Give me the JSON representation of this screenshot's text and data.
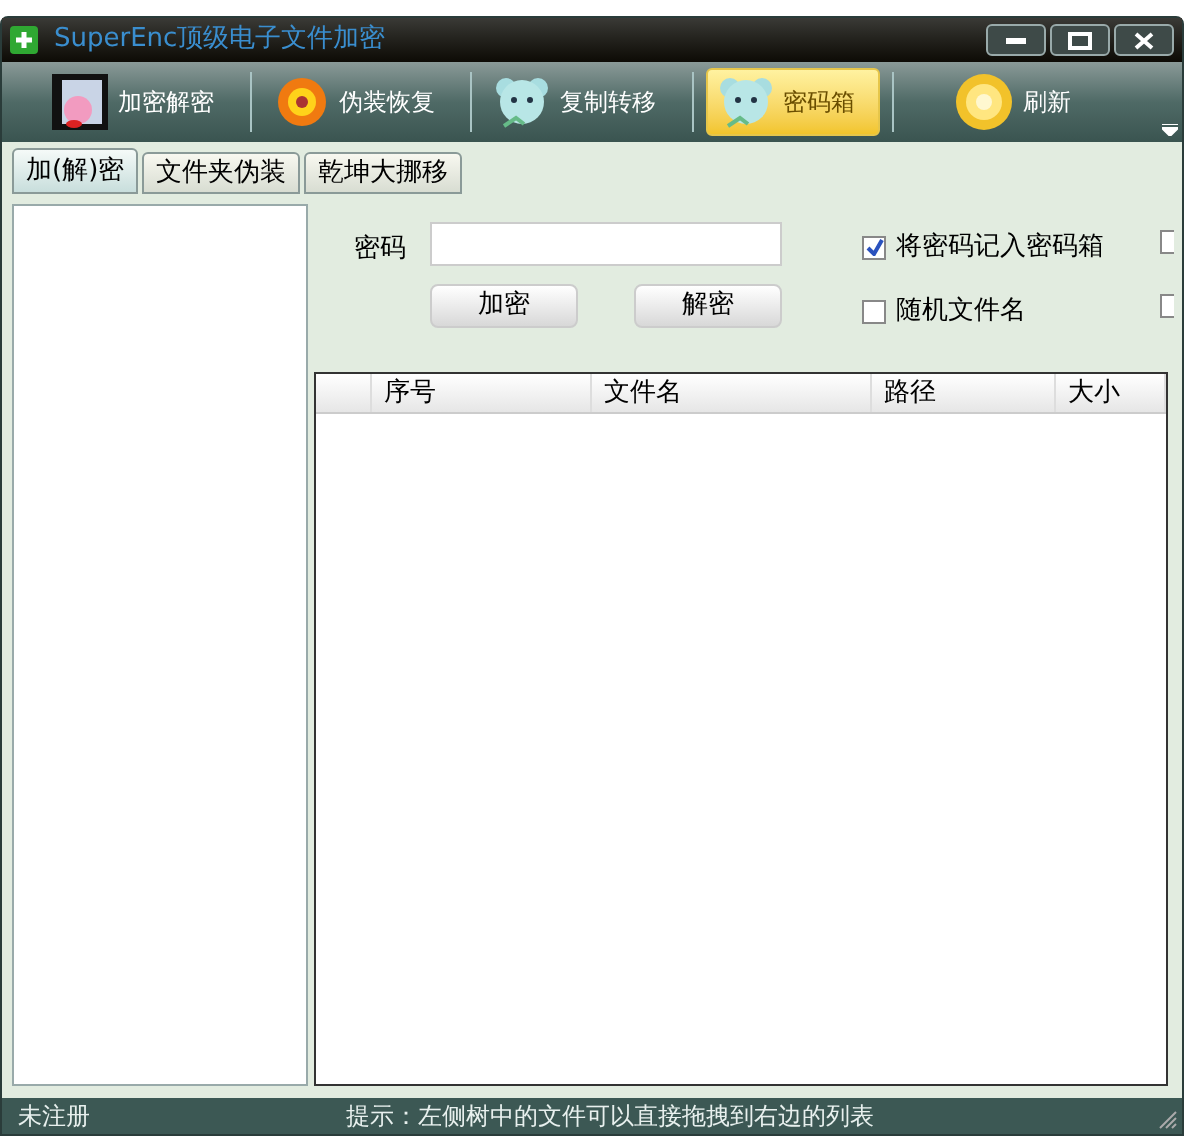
{
  "window": {
    "title": "SuperEnc顶级电子文件加密"
  },
  "toolbar": [
    {
      "label": "加密解密",
      "selected": false
    },
    {
      "label": "伪装恢复",
      "selected": false
    },
    {
      "label": "复制转移",
      "selected": false
    },
    {
      "label": "密码箱",
      "selected": true
    },
    {
      "label": "刷新",
      "selected": false
    }
  ],
  "tabs": [
    {
      "label": "加(解)密",
      "selected": true
    },
    {
      "label": "文件夹伪装",
      "selected": false
    },
    {
      "label": "乾坤大挪移",
      "selected": false
    }
  ],
  "password": {
    "label": "密码"
  },
  "buttons": [
    "加密",
    "解密"
  ],
  "options": [
    {
      "label": "将密码记入密码箱",
      "checked": true
    },
    {
      "label": "随机文件名",
      "checked": false
    }
  ],
  "cut_options": [
    {
      "checked": false
    },
    {
      "checked": false
    }
  ],
  "table": {
    "columns": [
      "序号",
      "文件名",
      "路径",
      "大小"
    ]
  },
  "status_bar": {
    "left": "未注册",
    "hint": "提示：左侧树中的文件可以直接拖拽到右边的列表"
  }
}
